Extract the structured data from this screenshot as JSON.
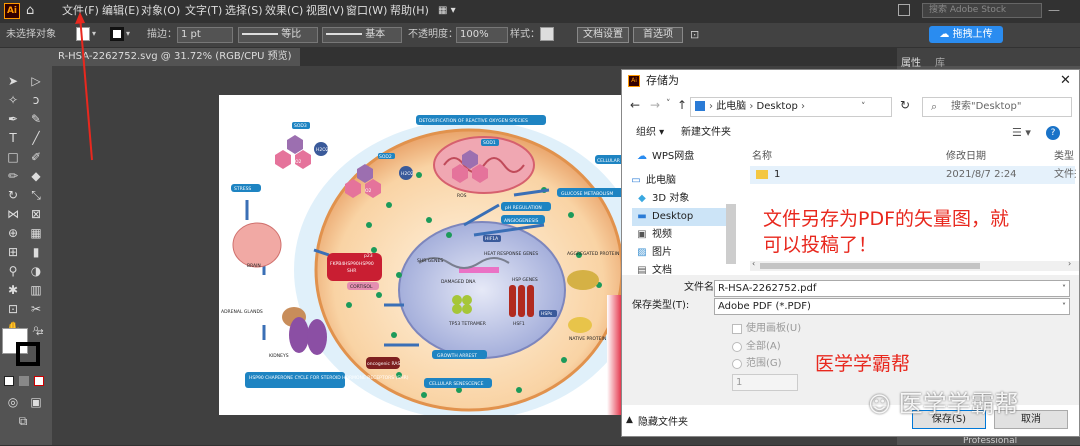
{
  "menubar": {
    "logo": "Ai",
    "items": [
      "文件(F)",
      "编辑(E)",
      "对象(O)",
      "文字(T)",
      "选择(S)",
      "效果(C)",
      "视图(V)",
      "窗口(W)",
      "帮助(H)"
    ],
    "search_placeholder": "搜索 Adobe Stock",
    "upload_label": "拖拽上传"
  },
  "control": {
    "no_selection": "未选择对象",
    "stroke_label": "描边：",
    "stroke_value": "1 pt",
    "uniform": "等比",
    "basic": "基本",
    "opacity_label": "不透明度：",
    "opacity_value": "100%",
    "style_label": "样式：",
    "doc_setup": "文档设置",
    "preferences": "首选项"
  },
  "doc_tab": "R-HSA-2262752.svg @ 31.72% (RGB/CPU 预览)",
  "panel": {
    "tab1": "属性",
    "tab2": "库",
    "bottom": "Professional"
  },
  "artwork": {
    "labels": [
      "DETOXIFICATION OF REACTIVE OXYGEN SPECIES",
      "STRESS",
      "BRAIN",
      "ADRENAL GLANDS",
      "KIDNEYS",
      "HSP90 CHAPERONE CYCLE FOR STEROID HORMONE RECEPTORS (SHR)",
      "CELLULAR SENESCENCE",
      "GROWTH ARREST",
      "TP53 TETRAMER",
      "DAMAGED DNA",
      "HEAT RESPONSE GENES",
      "GLUCOSE METABOLISM",
      "pH REGULATION",
      "ANGIOGENESIS",
      "HSP GENES",
      "HSF1",
      "AGGREGATED PROTEIN",
      "NATIVE PROTEIN",
      "CELLULAR",
      "oncogenic RAS",
      "SHR GENES",
      "SHR",
      "CORTISOL",
      "p23",
      "FKPB4",
      "HSP90",
      "HSP90",
      "SOD3",
      "SOD1",
      "ROS",
      "HIF1A",
      "HSPs",
      "TP53",
      "MAPK",
      "RB1",
      "SOD2",
      "CAT",
      "O2",
      "H2O2"
    ]
  },
  "dialog": {
    "title": "存储为",
    "breadcrumb": [
      "此电脑",
      "Desktop"
    ],
    "search_placeholder": "搜索\"Desktop\"",
    "organize": "组织 ▾",
    "new_folder": "新建文件夹",
    "nav": [
      "WPS网盘",
      "此电脑",
      "3D 对象",
      "Desktop",
      "视频",
      "图片",
      "文档"
    ],
    "columns": {
      "name": "名称",
      "date": "修改日期",
      "type": "类型"
    },
    "files": [
      {
        "name": "1",
        "date": "2021/8/7 2:24",
        "type": "文件夹"
      }
    ],
    "filename_label": "文件名(N):",
    "filename": "R-HSA-2262752.pdf",
    "filetype_label": "保存类型(T):",
    "filetype": "Adobe PDF (*.PDF)",
    "use_artboards": "使用画板(U)",
    "all": "全部(A)",
    "range": "范围(G)",
    "range_value": "1",
    "hide_folders": "隐藏文件夹",
    "save": "保存(S)",
    "cancel": "取消"
  },
  "annotations": {
    "line1": "文件另存为PDF的矢量图，就",
    "line2": "可以投稿了！",
    "site": "医学学霸帮",
    "watermark": "医学学霸帮"
  }
}
